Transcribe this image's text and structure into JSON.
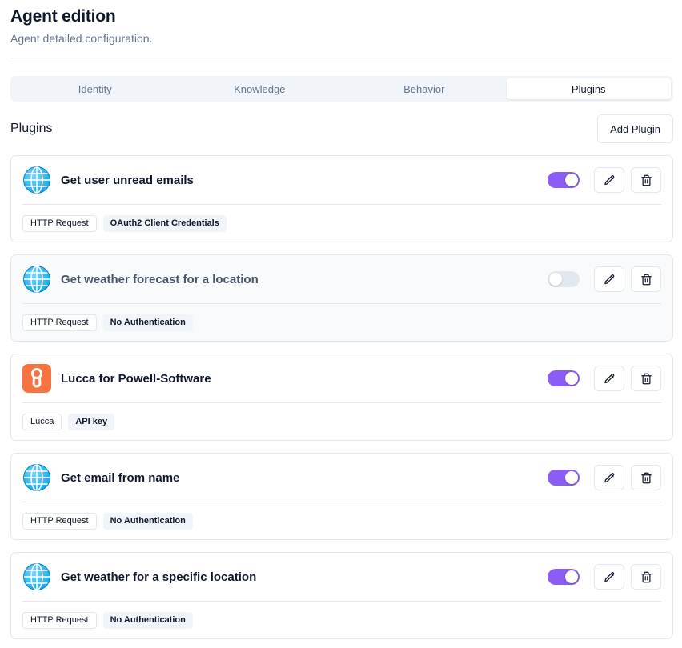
{
  "header": {
    "title": "Agent edition",
    "subtitle": "Agent detailed configuration."
  },
  "tabs": [
    {
      "label": "Identity",
      "active": false
    },
    {
      "label": "Knowledge",
      "active": false
    },
    {
      "label": "Behavior",
      "active": false
    },
    {
      "label": "Plugins",
      "active": true
    }
  ],
  "plugins_section": {
    "title": "Plugins",
    "add_label": "Add Plugin"
  },
  "colors": {
    "accent": "#8b5cf6",
    "globe": "#38bdf8",
    "lucca": "#f97341"
  },
  "plugins": [
    {
      "name": "Get user unread emails",
      "icon": "globe-icon",
      "enabled": true,
      "tags": [
        "HTTP Request",
        "OAuth2 Client Credentials"
      ]
    },
    {
      "name": "Get weather forecast for a location",
      "icon": "globe-icon",
      "enabled": false,
      "tags": [
        "HTTP Request",
        "No Authentication"
      ]
    },
    {
      "name": "Lucca for Powell-Software",
      "icon": "lucca-logo-icon",
      "enabled": true,
      "tags": [
        "Lucca",
        "API key"
      ]
    },
    {
      "name": "Get email from name",
      "icon": "globe-icon",
      "enabled": true,
      "tags": [
        "HTTP Request",
        "No Authentication"
      ]
    },
    {
      "name": "Get weather for a specific location",
      "icon": "globe-icon",
      "enabled": true,
      "tags": [
        "HTTP Request",
        "No Authentication"
      ]
    }
  ]
}
